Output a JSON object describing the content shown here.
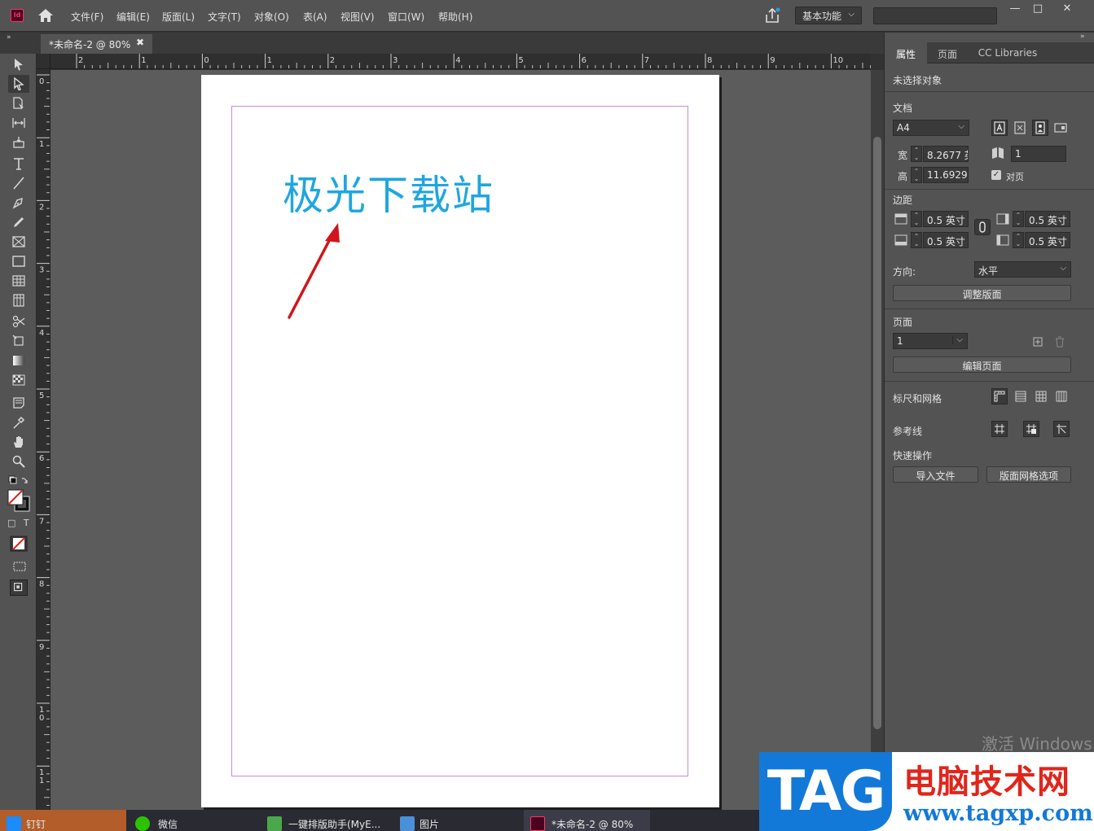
{
  "menubar": {
    "app_badge": "Id",
    "items": [
      "文件(F)",
      "编辑(E)",
      "版面(L)",
      "文字(T)",
      "对象(O)",
      "表(A)",
      "视图(V)",
      "窗口(W)",
      "帮助(H)"
    ],
    "workspace": "基本功能",
    "search_value": "",
    "controls": {
      "minimize": "—",
      "restore": "□",
      "close": "✕"
    }
  },
  "tabbar": {
    "collapse": "»",
    "doc_tab": "*未命名-2 @ 80%",
    "close": "✖"
  },
  "ruler": {
    "h_labels": [
      "2",
      "1",
      "0",
      "1",
      "2",
      "3",
      "4",
      "5",
      "6",
      "7",
      "8",
      "9",
      "10"
    ],
    "v_labels": [
      "0",
      "1",
      "2",
      "3",
      "4",
      "5",
      "6",
      "7",
      "8",
      "9",
      "1\n0",
      "1\n1"
    ]
  },
  "canvas": {
    "page_text": "极光下载站",
    "text_color": "#1fa6e0",
    "margin_color": "#c58cdc",
    "arrow_color": "#d0161b"
  },
  "tools": [
    "selection-tool-icon",
    "direct-selection-tool-icon",
    "page-tool-icon",
    "gap-tool-icon",
    "content-collector-icon",
    "type-tool-icon",
    "line-tool-icon",
    "pen-tool-icon",
    "pencil-tool-icon",
    "rectangle-frame-tool-icon",
    "rectangle-tool-icon",
    "table-rows-tool-icon",
    "table-columns-tool-icon",
    "scissors-tool-icon",
    "free-transform-tool-icon",
    "gradient-swatch-tool-icon",
    "gradient-feather-tool-icon",
    "note-tool-icon",
    "eyedropper-tool-icon",
    "hand-tool-icon",
    "zoom-tool-icon"
  ],
  "toolpanel": {
    "format_container": "□",
    "format_text": "T"
  },
  "rightpanel": {
    "collapse": "»",
    "tabs": [
      "属性",
      "页面",
      "CC Libraries"
    ],
    "no_selection": "未选择对象",
    "doc_section": "文档",
    "preset": "A4",
    "width_label": "宽",
    "width_value": "8.2677 英",
    "height_label": "高",
    "height_value": "11.6929",
    "pages_value": "1",
    "facing_pages_label": "对页",
    "facing_pages_checked": true,
    "margins_section": "边距",
    "margin_top": "0.5 英寸",
    "margin_bottom": "0.5 英寸",
    "margin_left": "0.5 英寸",
    "margin_right": "0.5 英寸",
    "orientation_label": "方向:",
    "orientation_value": "水平",
    "adjust_layout_button": "调整版面",
    "pages_section": "页面",
    "page_select_value": "1",
    "edit_page_button": "编辑页面",
    "rulers_grids_label": "标尺和网格",
    "guides_label": "参考线",
    "quick_actions_label": "快速操作",
    "import_file_button": "导入文件",
    "layout_grid_button": "版面网格选项"
  },
  "watermark": "激活 Windows",
  "taskbar": {
    "items": [
      "钉钉",
      "微信",
      "一键排版助手(MyE...",
      "图片",
      "*未命名-2 @ 80%"
    ]
  },
  "tag_logo": {
    "badge": "TAG",
    "title": "电脑技术网",
    "url": "www.tagxp.com"
  }
}
